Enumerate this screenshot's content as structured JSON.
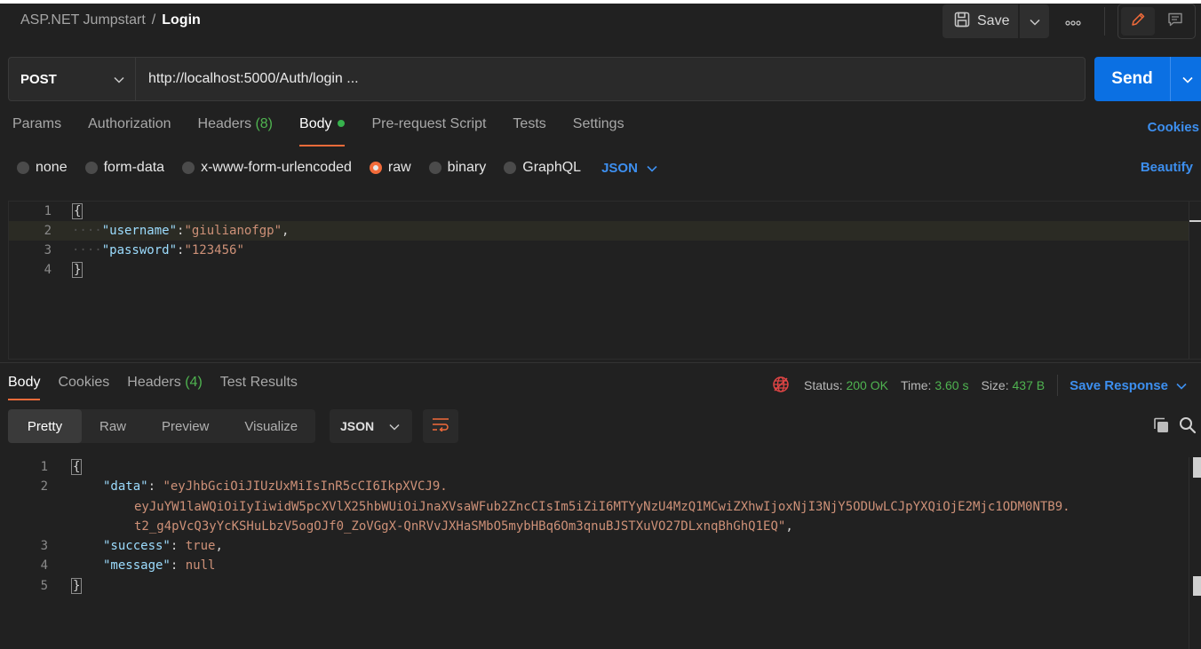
{
  "header": {
    "breadcrumb_parent": "ASP.NET Jumpstart",
    "breadcrumb_sep": "/",
    "breadcrumb_current": "Login",
    "save_label": "Save",
    "more_label": "ooo"
  },
  "request": {
    "method": "POST",
    "url": "http://localhost:5000/Auth/login ...",
    "send_label": "Send"
  },
  "req_tabs": {
    "params": "Params",
    "authorization": "Authorization",
    "headers": "Headers",
    "headers_count": "(8)",
    "body": "Body",
    "prerequest": "Pre-request Script",
    "tests": "Tests",
    "settings": "Settings",
    "cookies": "Cookies"
  },
  "body_types": {
    "none": "none",
    "form_data": "form-data",
    "urlencoded": "x-www-form-urlencoded",
    "raw": "raw",
    "binary": "binary",
    "graphql": "GraphQL",
    "language": "JSON",
    "beautify": "Beautify",
    "selected": "raw"
  },
  "request_body": {
    "ln1": "1",
    "ln2": "2",
    "ln3": "3",
    "ln4": "4",
    "open_brace": "{",
    "close_brace": "}",
    "dots": "····",
    "key1": "\"username\"",
    "val1": "\"giulianofgp\"",
    "key2": "\"password\"",
    "val2": "\"123456\"",
    "colon": ":",
    "comma": ","
  },
  "response": {
    "tab_body": "Body",
    "tab_cookies": "Cookies",
    "tab_headers": "Headers",
    "headers_count": "(4)",
    "tab_tests": "Test Results",
    "status_label": "Status:",
    "status_value": "200 OK",
    "time_label": "Time:",
    "time_value": "3.60 s",
    "size_label": "Size:",
    "size_value": "437 B",
    "save_response": "Save Response"
  },
  "view": {
    "pretty": "Pretty",
    "raw": "Raw",
    "preview": "Preview",
    "visualize": "Visualize",
    "format": "JSON"
  },
  "response_body": {
    "ln1": "1",
    "ln2": "2",
    "ln3": "3",
    "ln4": "4",
    "ln5": "5",
    "open_brace": "{",
    "close_brace": "}",
    "data_key": "\"data\"",
    "data_val_1": "\"eyJhbGciOiJIUzUxMiIsInR5cCI6IkpXVCJ9.",
    "data_val_2": "eyJuYW1laWQiOiIyIiwidW5pcXVlX25hbWUiOiJnaXVsaWFub2ZncCIsIm5iZiI6MTYyNzU4MzQ1MCwiZXhwIjoxNjI3NjY5ODUwLCJpYXQiOjE2Mjc1ODM0NTB9.",
    "data_val_3": "t2_g4pVcQ3yYcKSHuLbzV5ogOJf0_ZoVGgX-QnRVvJXHaSMbO5mybHBq6Om3qnuBJSTXuVO27DLxnqBhGhQ1EQ\"",
    "success_key": "\"success\"",
    "success_val": "true",
    "message_key": "\"message\"",
    "message_val": "null",
    "colon": ": ",
    "comma": ","
  },
  "colors": {
    "accent_orange": "#f26b3a",
    "send_blue": "#0b70e3",
    "link_blue": "#3d8fef",
    "status_green": "#4fb350",
    "json_key": "#9cdcfe",
    "json_string": "#ce9178"
  }
}
